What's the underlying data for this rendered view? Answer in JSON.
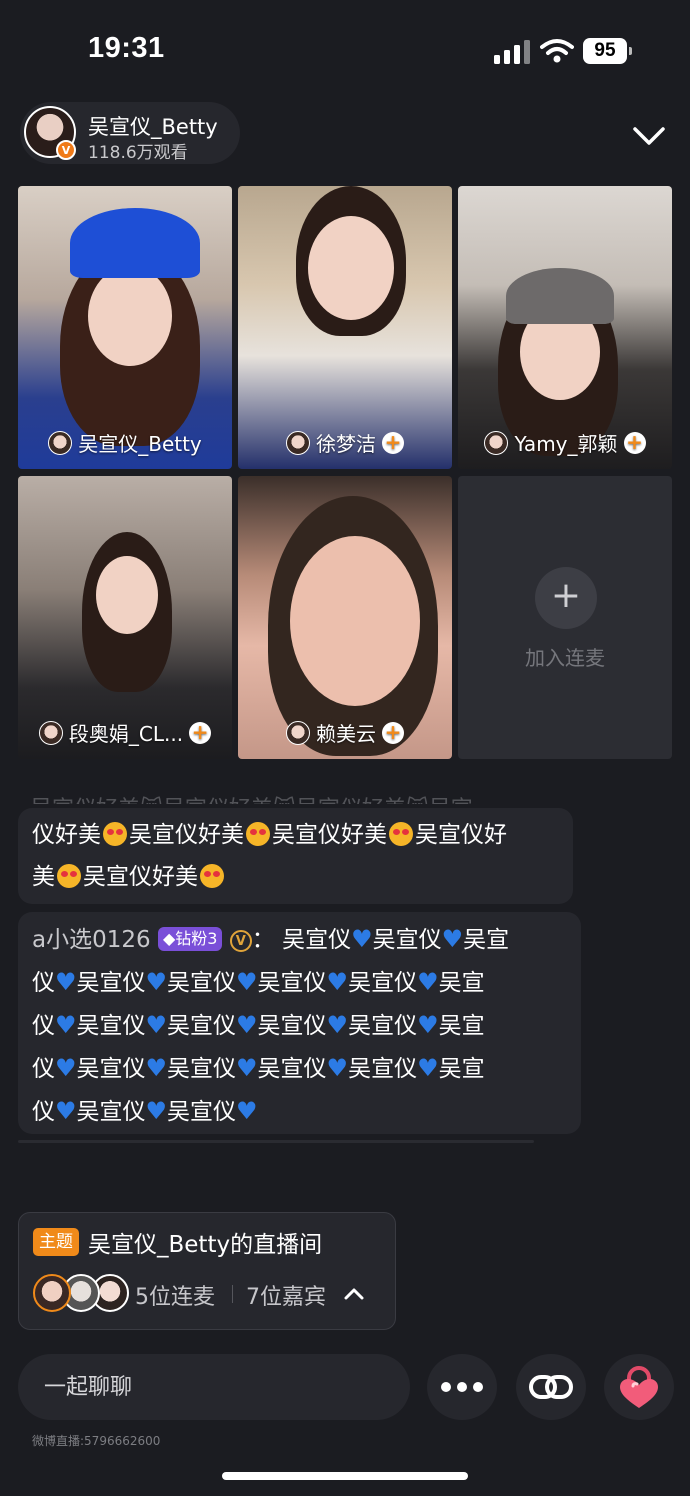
{
  "status_bar": {
    "time": "19:31",
    "battery": "95"
  },
  "host": {
    "name": "吴宣仪_Betty",
    "views": "118.6万观看",
    "verified_badge": "V"
  },
  "tiles": [
    {
      "name": "吴宣仪_Betty",
      "follow": ""
    },
    {
      "name": "徐梦洁",
      "follow": "+"
    },
    {
      "name": "Yamy_郭颖",
      "follow": "+"
    },
    {
      "name": "段奥娟_CL...",
      "follow": "+"
    },
    {
      "name": "赖美云",
      "follow": "+"
    }
  ],
  "join_tile": {
    "icon": "+",
    "label": "加入连麦"
  },
  "comments": {
    "faded": "吴宣仪好美😻吴宣仪好美😻吴宣仪好美😻吴宣",
    "c1": {
      "p1": "仪好美",
      "p2": "吴宣仪好美",
      "p3": "吴宣仪好美",
      "p4": "吴宣仪好",
      "p5": "美",
      "p6": "吴宣仪好美"
    },
    "c2": {
      "user": "a小选0126",
      "fan_badge": "钻粉3",
      "v_badge": "V",
      "sep": "：",
      "word": "吴宣仪",
      "line1_tail": "吴宣",
      "line_start": "仪",
      "line_tail": "吴宣"
    }
  },
  "topic": {
    "tag": "主题",
    "title": "吴宣仪_Betty的直播间",
    "linked": "5位连麦",
    "guests": "7位嘉宾"
  },
  "bottom_bar": {
    "chat_placeholder": "一起聊聊",
    "room_id": "微博直播:5796662600"
  },
  "icons": [
    "signal-icon",
    "wifi-icon",
    "chevron-down-icon",
    "plus-icon",
    "more-icon",
    "link-icon",
    "lock-icon",
    "chevron-up-icon"
  ],
  "colors": {
    "accent": "#f08a1a",
    "background": "#1b1c21",
    "panel": "#26272d",
    "heart": "#2c7be5",
    "lock": "#f25c7a"
  }
}
